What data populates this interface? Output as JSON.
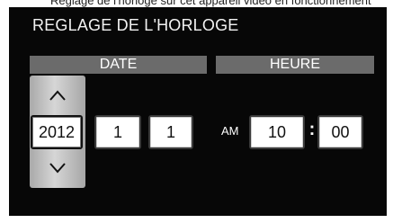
{
  "top_caption": "Réglage de l'horloge sur cet appareil vidéo en fonctionnement",
  "screen": {
    "title": "REGLAGE DE L'HORLOGE",
    "headers": {
      "date": "DATE",
      "time": "HEURE"
    },
    "date": {
      "year": "2012",
      "month": "1",
      "day": "1"
    },
    "time": {
      "ampm": "AM",
      "hour": "10",
      "separator": ":",
      "minute": "00"
    },
    "spinner_icons": {
      "up": "chevron-up-icon",
      "down": "chevron-down-icon"
    }
  },
  "colors": {
    "screen_background": "#070707",
    "header_bar": "#6b6b6b",
    "spinner": "#c8c8c8",
    "field_background": "#ffffff"
  }
}
